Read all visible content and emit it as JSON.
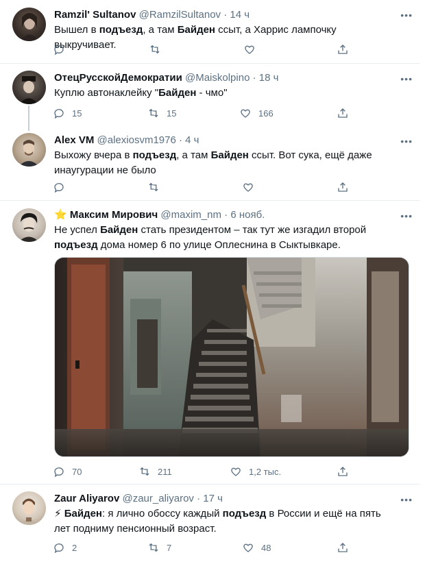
{
  "tweets": [
    {
      "name": "Ramzil' Sultanov",
      "handle": "@RamzilSultanov",
      "dot": "·",
      "time": "14 ч",
      "more": "•••",
      "text": [
        {
          "t": "Вышел в ",
          "b": false
        },
        {
          "t": "подъезд",
          "b": true
        },
        {
          "t": ", а там ",
          "b": false
        },
        {
          "t": "Байден",
          "b": true
        },
        {
          "t": " ссыт, а Харрис лампочку выкручивает.",
          "b": false
        }
      ],
      "reply_count": "",
      "retweet_count": "",
      "like_count": ""
    },
    {
      "name": "ОтецРусскойДемократии",
      "handle": "@Maiskolpino",
      "dot": "·",
      "time": "18 ч",
      "more": "•••",
      "text": [
        {
          "t": "Куплю автонаклейку \"",
          "b": false
        },
        {
          "t": "Байден",
          "b": true
        },
        {
          "t": " - чмо\"",
          "b": false
        }
      ],
      "reply_count": "15",
      "retweet_count": "15",
      "like_count": "166"
    },
    {
      "name": "Alex VM",
      "handle": "@alexiosvm1976",
      "dot": "·",
      "time": "4 ч",
      "more": "•••",
      "text": [
        {
          "t": "Выхожу вчера в ",
          "b": false
        },
        {
          "t": "подъезд",
          "b": true
        },
        {
          "t": ", а там ",
          "b": false
        },
        {
          "t": "Байден",
          "b": true
        },
        {
          "t": " ссыт. Вот сука, ещё даже инаугурации не было",
          "b": false
        }
      ],
      "reply_count": "",
      "retweet_count": "",
      "like_count": ""
    },
    {
      "name_prefix": "⭐",
      "name": "Максим Мирович",
      "handle": "@maxim_nm",
      "dot": "·",
      "time": "6 нояб.",
      "more": "•••",
      "text": [
        {
          "t": "Не успел ",
          "b": false
        },
        {
          "t": "Байден",
          "b": true
        },
        {
          "t": " стать президентом – так тут же изгадил второй ",
          "b": false
        },
        {
          "t": "подъезд",
          "b": true
        },
        {
          "t": " дома номер 6 по улице Оплеснина в Сыктывкаре.",
          "b": false
        }
      ],
      "reply_count": "70",
      "retweet_count": "211",
      "like_count": "1,2 тыс."
    },
    {
      "name": "Zaur Aliyarov",
      "handle": "@zaur_aliyarov",
      "dot": "·",
      "time": "17 ч",
      "more": "•••",
      "text": [
        {
          "t": "⚡ ",
          "b": false
        },
        {
          "t": "Байден",
          "b": true
        },
        {
          "t": ": я лично обоссу каждый ",
          "b": false
        },
        {
          "t": "подъезд",
          "b": true
        },
        {
          "t": " в России и ещё на пять лет подниму пенсионный возраст.",
          "b": false
        }
      ],
      "reply_count": "2",
      "retweet_count": "7",
      "like_count": "48"
    }
  ],
  "icons": {
    "reply": "reply-icon",
    "retweet": "retweet-icon",
    "like": "like-icon",
    "share": "share-icon"
  },
  "colors": {
    "text": "#0f1419",
    "secondary": "#5b7083",
    "divider": "#e6ecf0",
    "star": "#f5b820"
  }
}
